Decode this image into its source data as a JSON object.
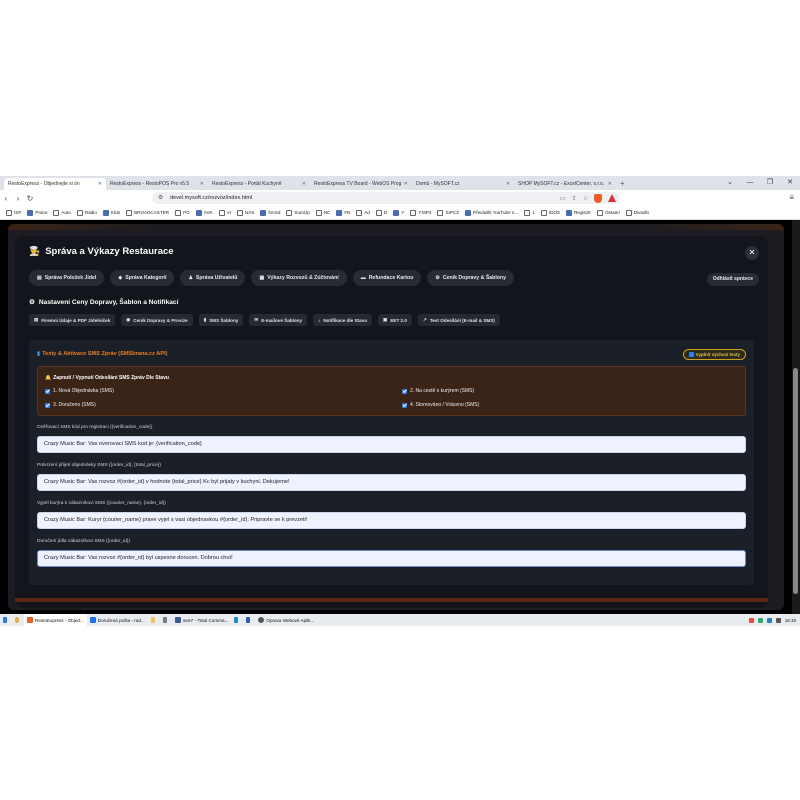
{
  "browser": {
    "tabs": [
      {
        "label": "RestoExpress - Objednejte si ón",
        "active": true
      },
      {
        "label": "RestoExpress - RestoPOS Pro v5.5",
        "active": false
      },
      {
        "label": "RestoExpress - Portál Kuchyně",
        "active": false
      },
      {
        "label": "RestoExpress TV Board - WebOS Prog",
        "active": false
      },
      {
        "label": "Domů - MySOFT.cz",
        "active": false
      },
      {
        "label": "SHOP MySOFT.cz - ExcelCenter, s.r.o.",
        "active": false
      }
    ],
    "new_tab": "+",
    "window_controls": [
      "⌄",
      "—",
      "❐",
      "✕"
    ],
    "url": "devel.mysoft.cz/rozvoz/index.html",
    "bookmarks": [
      "ISP",
      "Práce",
      "Auto",
      "Rádio",
      "Klub",
      "BROADCASTER",
      "PO",
      "AVK",
      "VI",
      "NAS",
      "NASd",
      "SumUp",
      "NC",
      "FB",
      "Ad",
      "D",
      "Y",
      "Y.MP3",
      "SIPCZ",
      "Převádět YouTube n...",
      "1",
      "IDOS",
      "Regisztr",
      "Ostatní",
      "Divadlo"
    ]
  },
  "modal": {
    "title": "Správa a Výkazy Restaurace",
    "close": "✕",
    "nav": [
      {
        "icon": "▤",
        "label": "Správa Položek Jídel"
      },
      {
        "icon": "◆",
        "label": "Správa Kategorií"
      },
      {
        "icon": "♟",
        "label": "Správa Uživatelů"
      },
      {
        "icon": "▦",
        "label": "Výkazy Rozvozů & Zúčtování"
      },
      {
        "icon": "▬",
        "label": "Refundace Kartou"
      },
      {
        "icon": "⚙",
        "label": "Ceník Dopravy & Šablony"
      }
    ],
    "logout": "Odhlásit správce",
    "section_title": "Nastavení Ceny Dopravy, Šablon a Notifikací",
    "subtabs": [
      {
        "icon": "▤",
        "label": "Firemní Údaje & PDF Jídelníček"
      },
      {
        "icon": "◉",
        "label": "Ceník Dopravy & Provize"
      },
      {
        "icon": "▮",
        "label": "SMS Šablony"
      },
      {
        "icon": "✉",
        "label": "E-mailové Šablony"
      },
      {
        "icon": "♪",
        "label": "Notifikace dle Stavu"
      },
      {
        "icon": "▣",
        "label": "EET 2.0"
      },
      {
        "icon": "↗",
        "label": "Test Odesílání (E-mail & SMS)"
      }
    ],
    "card": {
      "title": "Texty & Aktivace SMS Zpráv (SMSbrana.cz API)",
      "reset_label": "Vyplnit výchozí texty",
      "panel_title": "Zapnutí / Vypnutí Odesílání SMS Zpráv Dle Stavu",
      "checkboxes": [
        {
          "label": "1. Nová Objednávka (SMS)",
          "checked": true
        },
        {
          "label": "2. Na cestě s kurýrem (SMS)",
          "checked": true
        },
        {
          "label": "3. Doručeno (SMS)",
          "checked": true
        },
        {
          "label": "4. Stornováno / Vráceno (SMS)",
          "checked": true
        }
      ],
      "fields": [
        {
          "label": "Ověřovací SMS kód pro registraci ({verification_code})",
          "value": "Crazy Music Bar: Vas overovaci SMS kod je: {verification_code}"
        },
        {
          "label": "Potvrzení přijetí objednávky SMS ({order_id}, {total_price})",
          "value": "Crazy Music Bar: Vas rozvoz #{order_id} v hodnote {total_price} Kc byl prijaty v kuchyni. Dekujeme!"
        },
        {
          "label": "Vyjetí kurýra k zákazníkovi SMS ({courier_name}, {order_id})",
          "value": "Crazy Music Bar:  Kuryr {courier_name} prave vyjel s vasi objednavkou #{order_id}. Pripravte se k prevzeti!"
        },
        {
          "label": "Doručení jídla zákazníkovi SMS ({order_id})",
          "value": "Crazy Music Bar: Vas rozvoz #{order_id} byl uspesne dorucen. Dobrou chut!"
        }
      ]
    }
  },
  "taskbar": {
    "items": [
      "RestoExpress - Objed...",
      "Doručená pošta - rad...",
      "oem* - Total Comma...",
      "Oprava Webové Aplik..."
    ],
    "time": "16:19"
  },
  "colors": {
    "accent_orange": "#e67e22",
    "checkbox_blue": "#2f80ed",
    "panel_bg": "#3a2418"
  }
}
